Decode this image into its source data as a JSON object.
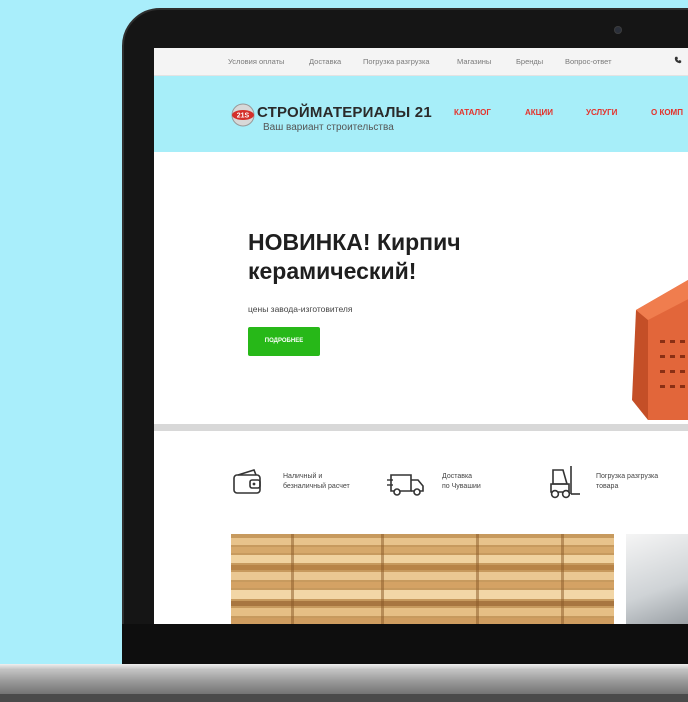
{
  "topbar": {
    "links": [
      "Условия оплаты",
      "Доставка",
      "Погрузка разгрузка",
      "Магазины",
      "Бренды",
      "Вопрос-ответ"
    ]
  },
  "header": {
    "logo_badge": "21S",
    "logo_title": "СТРОЙМАТЕРИАЛЫ 21",
    "logo_subtitle": "Ваш вариант строительства",
    "nav": [
      "КАТАЛОГ",
      "АКЦИИ",
      "УСЛУГИ",
      "О КОМП"
    ]
  },
  "hero": {
    "title": "НОВИНКА! Кирпич керамический!",
    "subtitle": "цены завода-изготовителя",
    "button_label": "ПОДРОБНЕЕ"
  },
  "features": [
    {
      "icon": "wallet-icon",
      "text_line1": "Наличный и",
      "text_line2": "безналичный расчет"
    },
    {
      "icon": "delivery-truck-icon",
      "text_line1": "Доставка",
      "text_line2": "по Чувашии"
    },
    {
      "icon": "forklift-icon",
      "text_line1": "Погрузка разгрузка",
      "text_line2": "товара"
    }
  ],
  "colors": {
    "background": "#a9eefb",
    "header_bg": "#a7eef9",
    "nav_red": "#e4322b",
    "button_green": "#27b818"
  }
}
